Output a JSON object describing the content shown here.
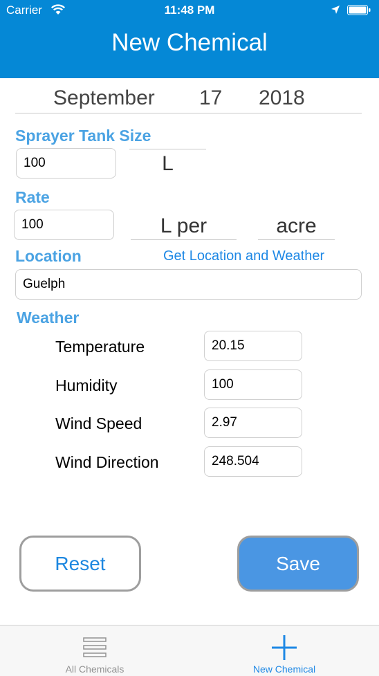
{
  "status_bar": {
    "carrier": "Carrier",
    "time": "11:48 PM"
  },
  "header": {
    "title": "New Chemical"
  },
  "date_picker": {
    "month": "September",
    "day": "17",
    "year": "2018"
  },
  "sprayer": {
    "label": "Sprayer Tank Size",
    "value": "100",
    "unit": "L"
  },
  "rate": {
    "label": "Rate",
    "value": "100",
    "unit_volume": "L per",
    "unit_area": "acre"
  },
  "location": {
    "label": "Location",
    "link": "Get Location and Weather",
    "value": "Guelph"
  },
  "weather": {
    "label": "Weather",
    "rows": [
      {
        "label": "Temperature",
        "value": "20.15"
      },
      {
        "label": "Humidity",
        "value": "100"
      },
      {
        "label": "Wind Speed",
        "value": "2.97"
      },
      {
        "label": "Wind Direction",
        "value": "248.504"
      }
    ]
  },
  "buttons": {
    "reset": "Reset",
    "save": "Save"
  },
  "tabs": [
    {
      "label": "All Chemicals",
      "icon": "list-icon"
    },
    {
      "label": "New Chemical",
      "icon": "plus-icon"
    }
  ],
  "colors": {
    "header": "#0588d6",
    "section": "#4ba3e3",
    "link": "#1e88e5",
    "save": "#4a96e3",
    "tab_active": "#1e88e5",
    "tab_inactive": "#929292"
  }
}
